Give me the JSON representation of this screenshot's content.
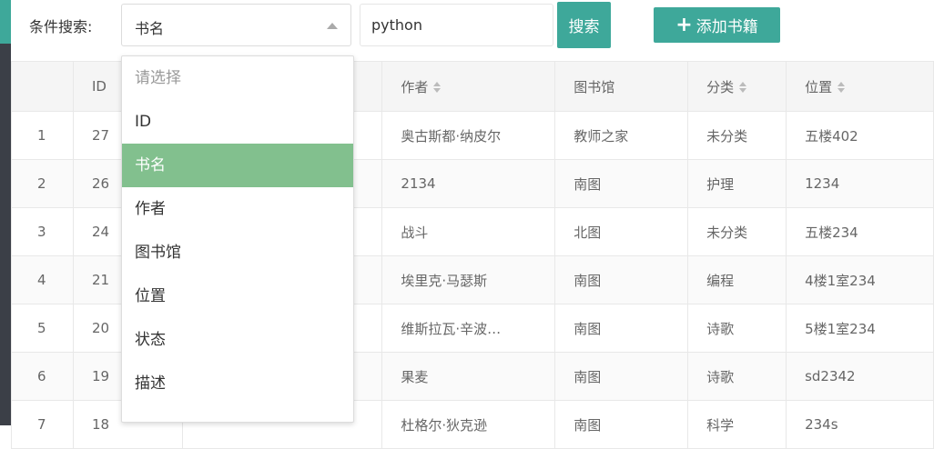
{
  "search": {
    "label": "条件搜索:",
    "field_selected": "书名",
    "keyword_value": "python",
    "search_button": "搜索",
    "add_button": "添加书籍"
  },
  "dropdown": {
    "options": [
      "请选择",
      "ID",
      "书名",
      "作者",
      "图书馆",
      "位置",
      "状态",
      "描述"
    ],
    "selected": "书名"
  },
  "table": {
    "headers": {
      "id": "ID",
      "author": "作者",
      "library": "图书馆",
      "category": "分类",
      "location": "位置"
    },
    "rows": [
      {
        "idx": "1",
        "id": "27",
        "author": "奥古斯都·纳皮尔",
        "library": "教师之家",
        "category": "未分类",
        "location": "五楼402"
      },
      {
        "idx": "2",
        "id": "26",
        "author": "2134",
        "library": "南图",
        "category": "护理",
        "location": "1234"
      },
      {
        "idx": "3",
        "id": "24",
        "author": "战斗",
        "library": "北图",
        "category": "未分类",
        "location": "五楼234"
      },
      {
        "idx": "4",
        "id": "21",
        "author": "埃里克·马瑟斯",
        "library": "南图",
        "category": "编程",
        "location": "4楼1室234"
      },
      {
        "idx": "5",
        "id": "20",
        "author": "维斯拉瓦·辛波…",
        "library": "南图",
        "category": "诗歌",
        "location": "5楼1室234"
      },
      {
        "idx": "6",
        "id": "19",
        "author": "果麦",
        "library": "南图",
        "category": "诗歌",
        "location": "sd2342"
      },
      {
        "idx": "7",
        "id": "18",
        "author": "杜格尔·狄克逊",
        "library": "南图",
        "category": "科学",
        "location": "234s"
      }
    ]
  },
  "colors": {
    "accent": "#3ea89a",
    "selected_option": "#82c08e",
    "sidebar": "#3b3f47"
  }
}
